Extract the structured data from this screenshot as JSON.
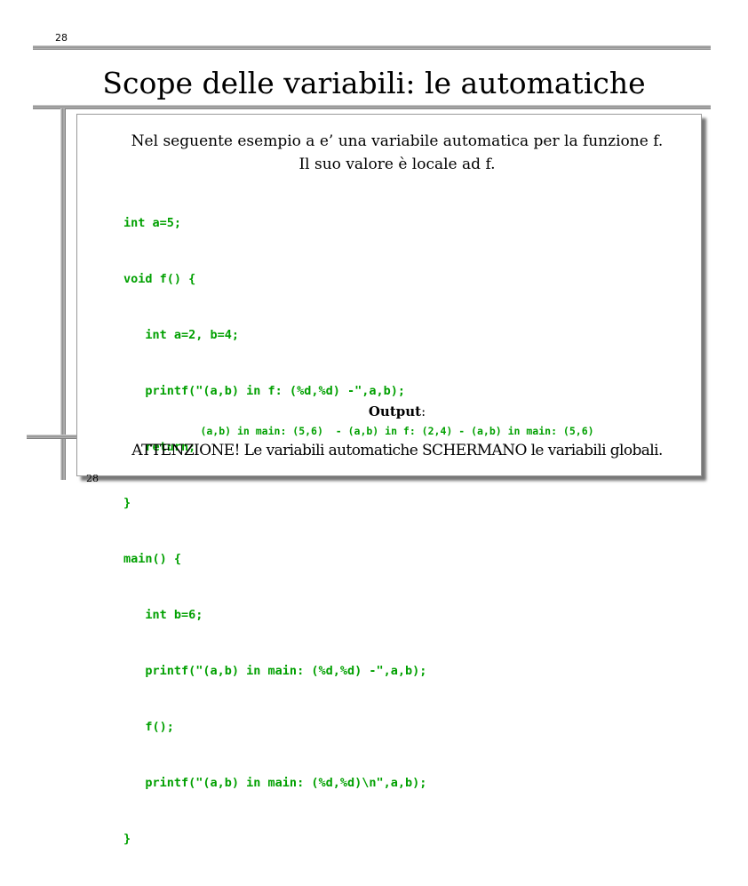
{
  "page_number_top": "28",
  "page_number_bottom": "28",
  "title": "Scope delle variabili: le automatiche",
  "intro": [
    "Nel seguente esempio a e’ una variabile automatica per la funzione f.",
    "Il suo valore è locale ad f."
  ],
  "code": [
    "int a=5;",
    "void f() {",
    "   int a=2, b=4;",
    "   printf(\"(a,b) in f: (%d,%d) -\",a,b);",
    "   return;",
    "}",
    "main() {",
    "   int b=6;",
    "   printf(\"(a,b) in main: (%d,%d) -\",a,b);",
    "   f();",
    "   printf(\"(a,b) in main: (%d,%d)\\n\",a,b);",
    "}"
  ],
  "output_label": "Output",
  "output_colon": ":",
  "output_text": "(a,b) in main: (5,6)  - (a,b) in f: (2,4) - (a,b) in main: (5,6)",
  "attention": "ATTENZIONE! Le variabili automatiche SCHERMANO le variabili globali.",
  "colors": {
    "code": "#00a000"
  }
}
